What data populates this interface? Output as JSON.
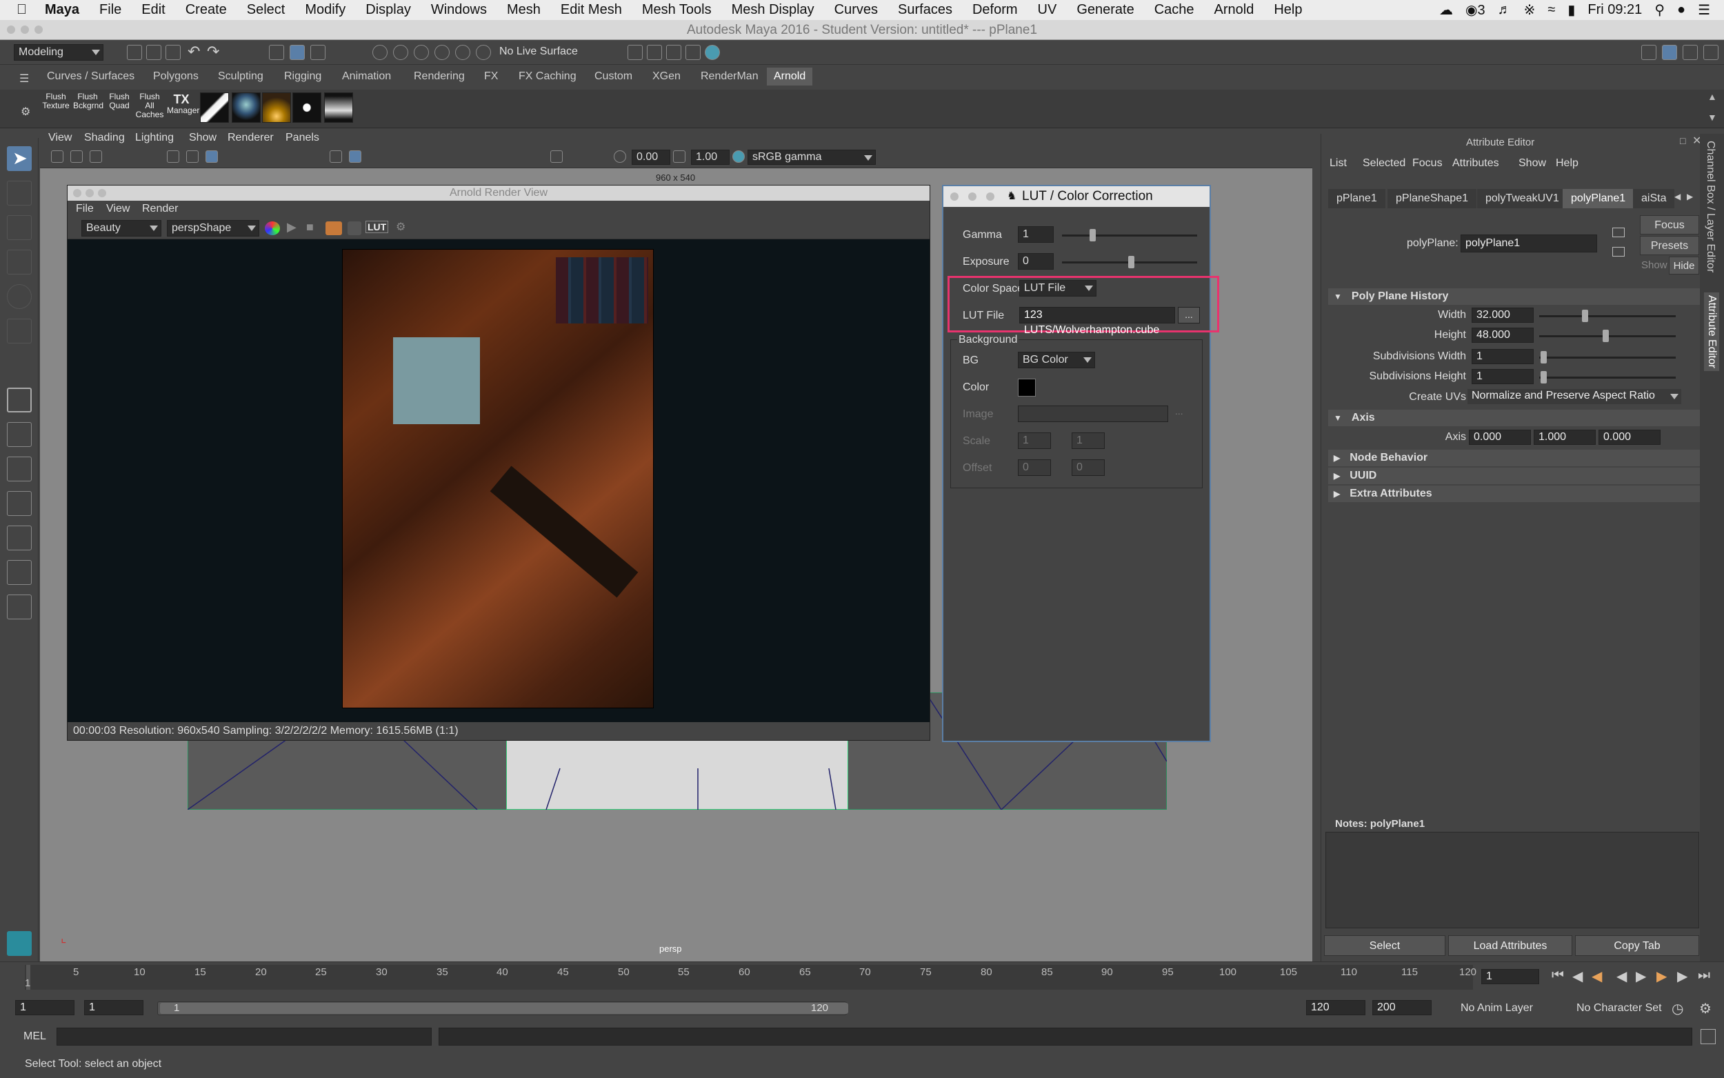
{
  "mac_menu": {
    "app": "Maya",
    "items": [
      "File",
      "Edit",
      "Create",
      "Select",
      "Modify",
      "Display",
      "Windows",
      "Mesh",
      "Edit Mesh",
      "Mesh Tools",
      "Mesh Display",
      "Curves",
      "Surfaces",
      "Deform",
      "UV",
      "Generate",
      "Cache",
      "Arnold",
      "Help"
    ],
    "status_count": "3",
    "clock": "Fri 09:21"
  },
  "window_title": "Autodesk Maya 2016 - Student Version: untitled*   ---   pPlane1",
  "status_line": {
    "mode": "Modeling",
    "live_surface": "No Live Surface"
  },
  "shelf": {
    "tabs": [
      "Curves / Surfaces",
      "Polygons",
      "Sculpting",
      "Rigging",
      "Animation",
      "Rendering",
      "FX",
      "FX Caching",
      "Custom",
      "XGen",
      "RenderMan",
      "Arnold"
    ],
    "active_tab": "Arnold",
    "buttons": [
      {
        "line1": "Flush",
        "line2": "Texture"
      },
      {
        "line1": "Flush",
        "line2": "Bckgrnd"
      },
      {
        "line1": "Flush",
        "line2": "Quad"
      },
      {
        "line1": "Flush",
        "line2": "All Caches"
      },
      {
        "line1": "TX",
        "line2": "Manager"
      }
    ]
  },
  "viewport": {
    "menu": [
      "View",
      "Shading",
      "Lighting",
      "Show",
      "Renderer",
      "Panels"
    ],
    "exposure": "0.00",
    "gamma": "1.00",
    "color_space": "sRGB gamma",
    "resolution_label": "960 x 540",
    "camera_label": "persp"
  },
  "render_view": {
    "title": "Arnold Render View",
    "menu": [
      "File",
      "View",
      "Render"
    ],
    "aov": "Beauty",
    "camera": "perspShape",
    "lut_label": "LUT",
    "status": "00:00:03  Resolution: 960x540  Sampling: 3/2/2/2/2/2 Memory: 1615.56MB (1:1)"
  },
  "lut_window": {
    "title": "LUT / Color Correction",
    "gamma_label": "Gamma",
    "gamma_value": "1",
    "exposure_label": "Exposure",
    "exposure_value": "0",
    "color_space_label": "Color Space",
    "color_space_value": "LUT File",
    "lut_file_label": "LUT File",
    "lut_file_value": "123 LUTS/Wolverhampton.cube",
    "browse_label": "...",
    "background_label": "Background",
    "bg_label": "BG",
    "bg_value": "BG Color",
    "color_label": "Color",
    "image_label": "Image",
    "image_browse": "...",
    "scale_label": "Scale",
    "scale_x": "1",
    "scale_y": "1",
    "offset_label": "Offset",
    "offset_x": "0",
    "offset_y": "0",
    "highlight_color": "#e8336e"
  },
  "attribute_editor": {
    "title": "Attribute Editor",
    "menu": [
      "List",
      "Selected",
      "Focus",
      "Attributes",
      "Show",
      "Help"
    ],
    "tabs": [
      "pPlane1",
      "pPlaneShape1",
      "polyTweakUV1",
      "polyPlane1",
      "aiSta"
    ],
    "active_tab": "polyPlane1",
    "node_label": "polyPlane:",
    "node_value": "polyPlane1",
    "focus_btn": "Focus",
    "presets_btn": "Presets",
    "show_label": "Show",
    "hide_btn": "Hide",
    "section_history": "Poly Plane History",
    "width_label": "Width",
    "width_value": "32.000",
    "width_level": 0.3,
    "height_label": "Height",
    "height_value": "48.000",
    "height_level": 0.45,
    "subdiv_w_label": "Subdivisions Width",
    "subdiv_w_value": "1",
    "subdiv_h_label": "Subdivisions Height",
    "subdiv_h_value": "1",
    "create_uvs_label": "Create UVs",
    "create_uvs_value": "Normalize and Preserve Aspect Ratio",
    "section_axis": "Axis",
    "axis_label": "Axis",
    "axis_x": "0.000",
    "axis_y": "1.000",
    "axis_z": "0.000",
    "section_node_behavior": "Node Behavior",
    "section_uuid": "UUID",
    "section_extra": "Extra Attributes",
    "notes_label": "Notes:  polyPlane1",
    "select_btn": "Select",
    "load_btn": "Load Attributes",
    "copy_btn": "Copy Tab"
  },
  "side_tabs": [
    "Channel Box / Layer Editor",
    "Attribute Editor"
  ],
  "timeline": {
    "ticks": [
      "1",
      "5",
      "10",
      "15",
      "20",
      "25",
      "30",
      "35",
      "40",
      "45",
      "50",
      "55",
      "60",
      "65",
      "70",
      "75",
      "80",
      "85",
      "90",
      "95",
      "100",
      "105",
      "110",
      "115",
      "120"
    ],
    "current_frame": "1"
  },
  "range": {
    "start": "1",
    "playback_start": "1",
    "slider_start": "1",
    "slider_end": "120",
    "playback_end": "120",
    "end": "200",
    "anim_layer": "No Anim Layer",
    "char_set": "No Character Set"
  },
  "mel_label": "MEL",
  "help_line": "Select Tool: select an object"
}
